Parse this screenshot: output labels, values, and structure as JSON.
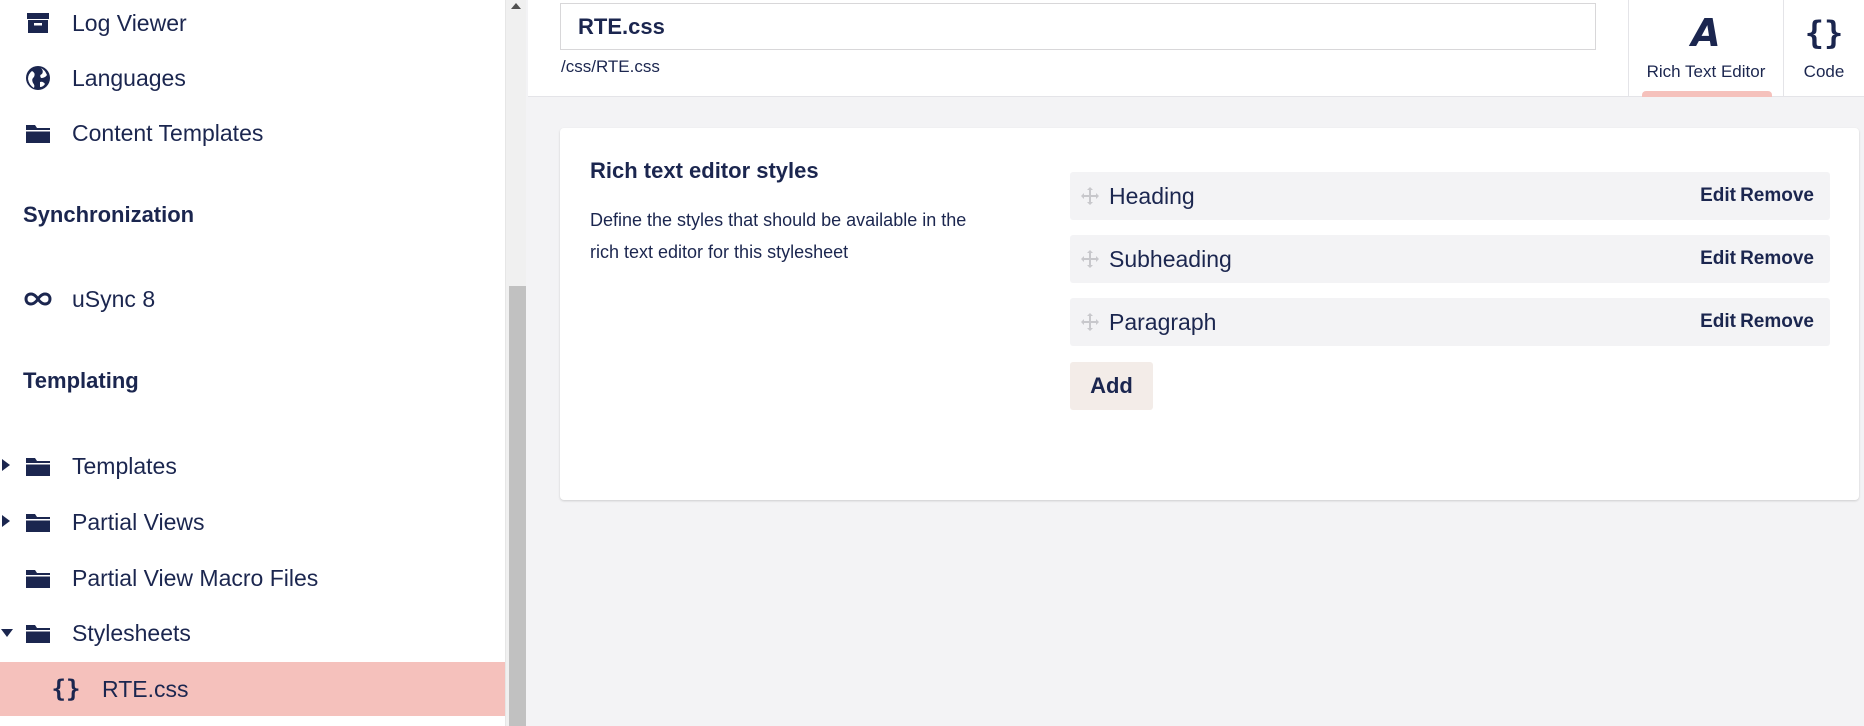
{
  "sidebar": {
    "items": [
      {
        "label": "Log Viewer",
        "icon": "archive-icon"
      },
      {
        "label": "Languages",
        "icon": "globe-icon"
      },
      {
        "label": "Content Templates",
        "icon": "folder-icon"
      }
    ],
    "sections": [
      {
        "title": "Synchronization",
        "items": [
          {
            "label": "uSync 8",
            "icon": "infinity-icon"
          }
        ]
      },
      {
        "title": "Templating",
        "items": [
          {
            "label": "Templates",
            "icon": "folder-icon",
            "expanded": false
          },
          {
            "label": "Partial Views",
            "icon": "folder-icon",
            "expanded": false
          },
          {
            "label": "Partial View Macro Files",
            "icon": "folder-icon"
          },
          {
            "label": "Stylesheets",
            "icon": "folder-icon",
            "expanded": true
          },
          {
            "label": "RTE.css",
            "icon": "code-braces-icon",
            "selected": true
          }
        ]
      }
    ]
  },
  "header": {
    "name_value": "RTE.css",
    "path": "/css/RTE.css",
    "tabs": [
      {
        "label": "Rich Text Editor",
        "glyph": "A",
        "active": true
      },
      {
        "label": "Code",
        "glyph": "{}",
        "active": false
      }
    ]
  },
  "panel": {
    "title": "Rich text editor styles",
    "description": "Define the styles that should be available in the rich text editor for this stylesheet",
    "rows": [
      {
        "label": "Heading",
        "edit": "Edit",
        "remove": "Remove"
      },
      {
        "label": "Subheading",
        "edit": "Edit",
        "remove": "Remove"
      },
      {
        "label": "Paragraph",
        "edit": "Edit",
        "remove": "Remove"
      }
    ],
    "add_label": "Add"
  },
  "colors": {
    "text": "#1b264f",
    "selected": "#f5c1bc",
    "row_bg": "#f3f3f5",
    "add_bg": "#f3ece8"
  }
}
